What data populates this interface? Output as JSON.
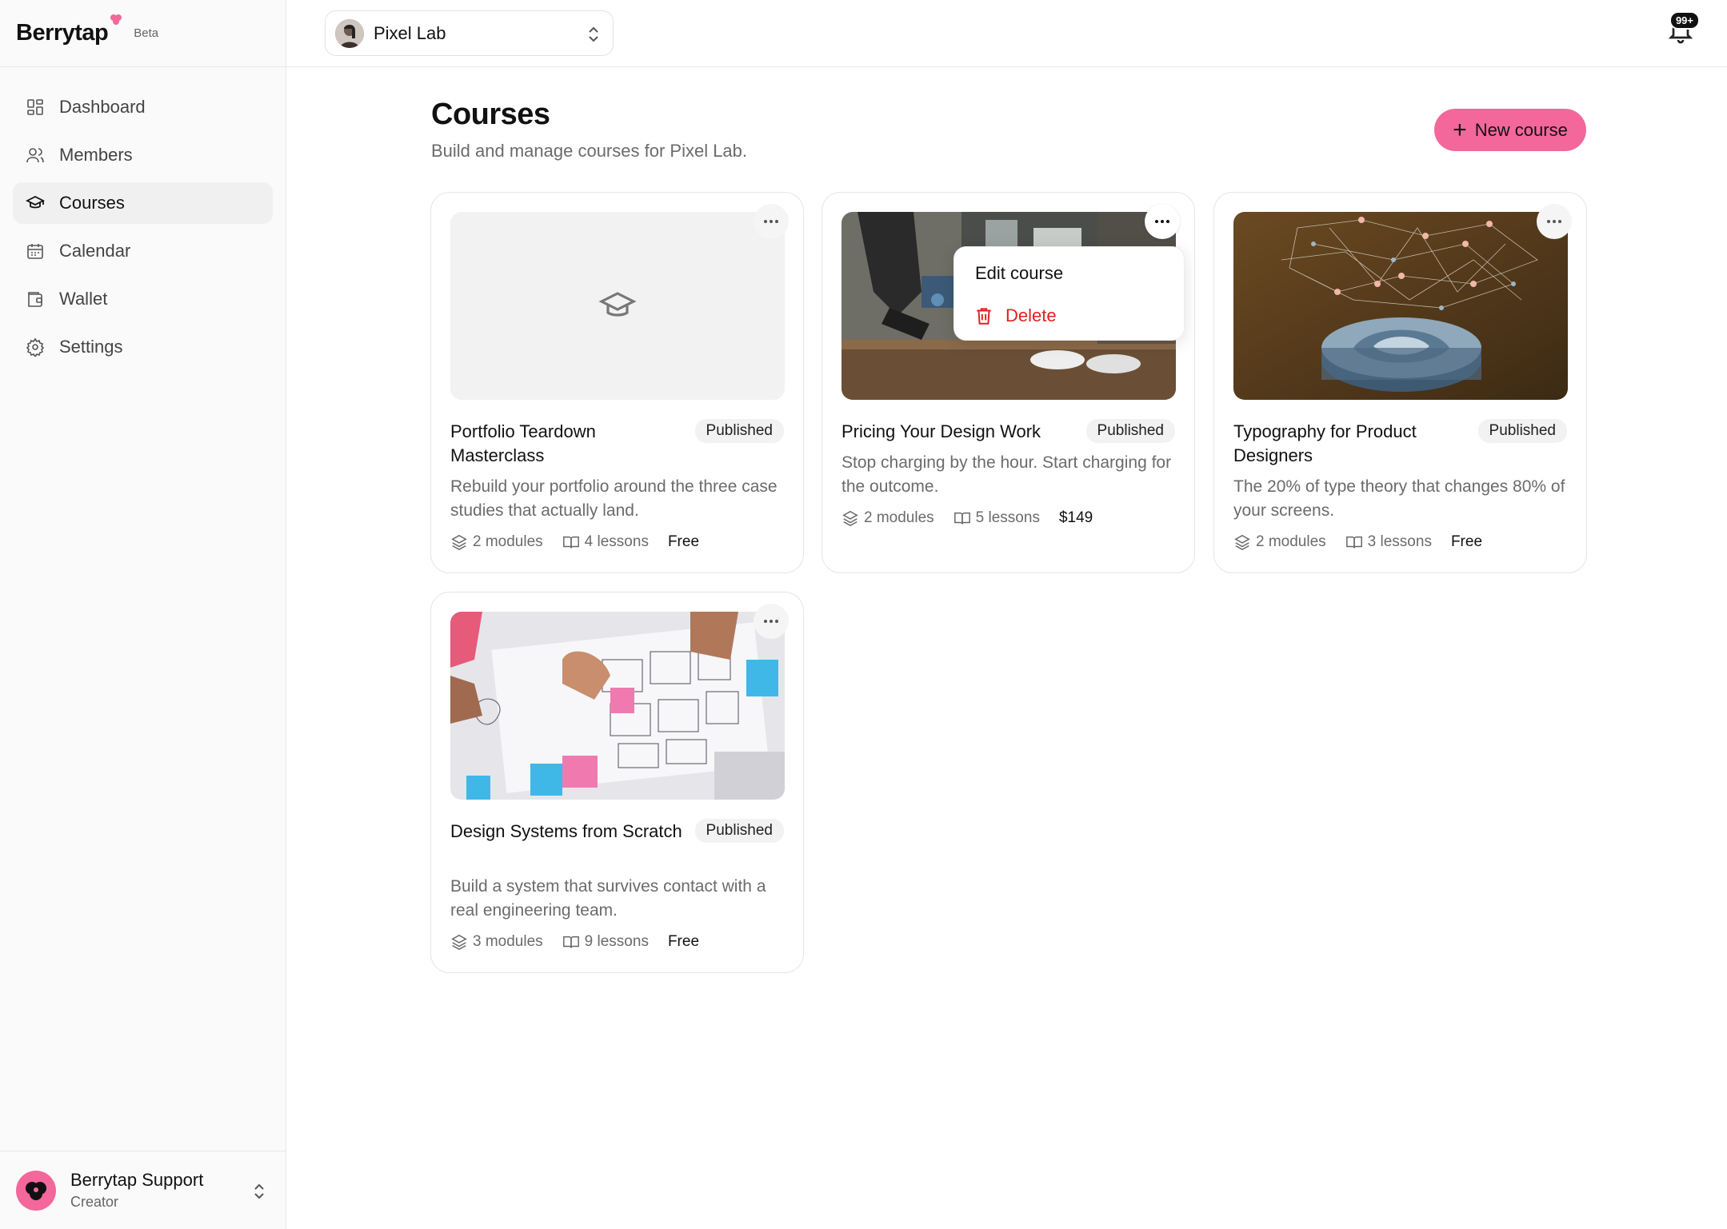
{
  "brand": {
    "name": "Berrytap",
    "tag": "Beta"
  },
  "nav": [
    {
      "label": "Dashboard",
      "icon": "dashboard-icon"
    },
    {
      "label": "Members",
      "icon": "members-icon"
    },
    {
      "label": "Courses",
      "icon": "graduation-cap-icon",
      "active": true
    },
    {
      "label": "Calendar",
      "icon": "calendar-icon"
    },
    {
      "label": "Wallet",
      "icon": "wallet-icon"
    },
    {
      "label": "Settings",
      "icon": "gear-icon"
    }
  ],
  "user": {
    "name": "Berrytap Support",
    "role": "Creator"
  },
  "workspace": {
    "name": "Pixel Lab"
  },
  "notifications": {
    "count": "99+"
  },
  "page": {
    "title": "Courses",
    "subtitle": "Build and manage courses for Pixel Lab.",
    "new_button": "New course"
  },
  "courses": [
    {
      "title": "Portfolio Teardown Masterclass",
      "status": "Published",
      "description": "Rebuild your portfolio around the three case studies that actually land.",
      "modules": "2 modules",
      "lessons": "4 lessons",
      "price": "Free"
    },
    {
      "title": "Pricing Your Design Work",
      "status": "Published",
      "description": "Stop charging by the hour. Start charging for the outcome.",
      "modules": "2 modules",
      "lessons": "5 lessons",
      "price": "$149"
    },
    {
      "title": "Typography for Product Designers",
      "status": "Published",
      "description": "The 20% of type theory that changes 80% of your screens.",
      "modules": "2 modules",
      "lessons": "3 lessons",
      "price": "Free"
    },
    {
      "title": "Design Systems from Scratch",
      "status": "Published",
      "description": "Build a system that survives contact with a real engineering team.",
      "modules": "3 modules",
      "lessons": "9 lessons",
      "price": "Free"
    }
  ],
  "menu": {
    "edit": "Edit course",
    "delete": "Delete"
  },
  "colors": {
    "accent": "#f4679a",
    "danger": "#e02020"
  }
}
